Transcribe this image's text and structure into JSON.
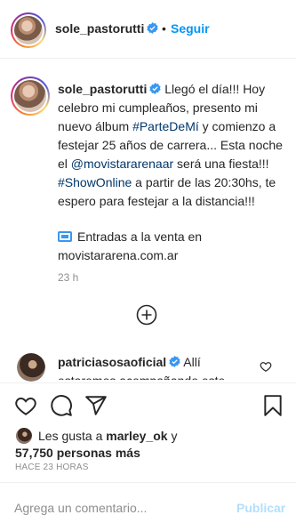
{
  "header": {
    "username": "sole_pastorutti",
    "separator": "•",
    "follow_label": "Seguir"
  },
  "caption": {
    "username": "sole_pastorutti",
    "text_1": "Llegó el día!!! Hoy celebro mi cumpleaños, presento mi nuevo álbum ",
    "hashtag_1": "#ParteDeMí",
    "text_2": " y comienzo a festejar 25 años de carrera... Esta noche el ",
    "mention": "@movistararenaar",
    "text_3": " será una fiesta!!! ",
    "hashtag_2": "#ShowOnline",
    "text_4": " a partir de las 20:30hs, te espero para festejar a la distancia!!!",
    "tickets_line": "Entradas a la venta en movistararena.com.ar",
    "time_ago": "23 h"
  },
  "comment": {
    "username": "patriciasosaoficial",
    "text": "Allí estaremos acompañando este"
  },
  "likes": {
    "prefix": "Les gusta a ",
    "user": "marley_ok",
    "connector": " y",
    "count": "57,750 personas más"
  },
  "posted": "HACE 23 HORAS",
  "comment_box": {
    "placeholder": "Agrega un comentario...",
    "publish_label": "Publicar"
  },
  "icons": [
    "verified-badge-icon",
    "add-more-comments-icon",
    "heart-icon",
    "comment-icon",
    "share-icon",
    "bookmark-icon",
    "ticket-icon"
  ],
  "colors": {
    "accent": "#0095f6",
    "link": "#00376b",
    "muted": "#8e8e8e",
    "publish_disabled": "#b2dffc"
  }
}
